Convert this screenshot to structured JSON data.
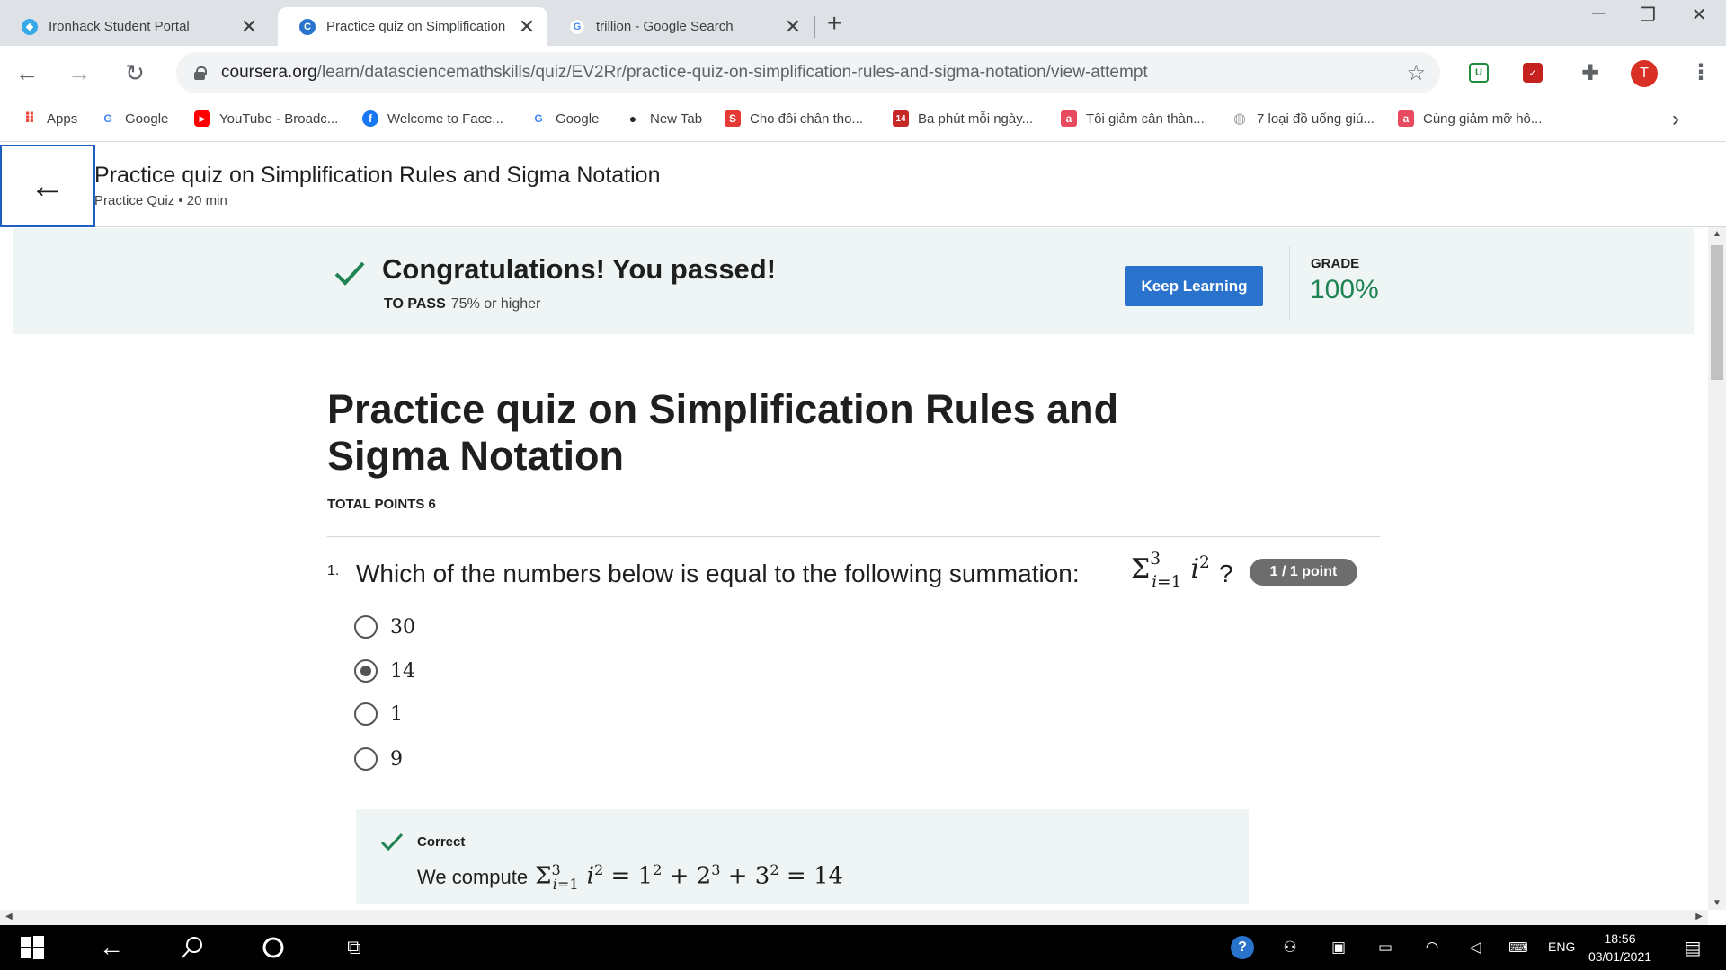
{
  "browser": {
    "tabs": [
      {
        "title": "Ironhack Student Portal",
        "active": false
      },
      {
        "title": "Practice quiz on Simplification",
        "active": true
      },
      {
        "title": "trillion - Google Search",
        "active": false
      }
    ],
    "new_tab_icon": "+",
    "url_host": "coursera.org",
    "url_path": "/learn/datasciencemathskills/quiz/EV2Rr/practice-quiz-on-simplification-rules-and-sigma-notation/view-attempt",
    "profile_initial": "T",
    "bookmarks": [
      {
        "label": "Apps",
        "icon": "apps-grid-icon"
      },
      {
        "label": "Google",
        "icon": "google-icon"
      },
      {
        "label": "YouTube - Broadc...",
        "icon": "youtube-icon"
      },
      {
        "label": "Welcome to Face...",
        "icon": "facebook-icon"
      },
      {
        "label": "Google",
        "icon": "google-icon"
      },
      {
        "label": "New Tab",
        "icon": "github-icon"
      },
      {
        "label": "Cho đôi chân tho...",
        "icon": "s-icon"
      },
      {
        "label": "Ba phút mỗi ngày...",
        "icon": "14-icon"
      },
      {
        "label": "Tôi giảm cân thàn...",
        "icon": "a-icon"
      },
      {
        "label": "7 loại đồ uống giú...",
        "icon": "globe-icon"
      },
      {
        "label": "Cùng giảm mỡ hô...",
        "icon": "a-icon"
      }
    ]
  },
  "header": {
    "title": "Practice quiz on Simplification Rules and Sigma Notation",
    "subtitle": "Practice Quiz • 20 min"
  },
  "result": {
    "message": "Congratulations! You passed!",
    "to_pass_label": "TO PASS",
    "to_pass_value": "75% or higher",
    "button_label": "Keep Learning",
    "grade_label": "GRADE",
    "grade_value": "100%"
  },
  "quiz": {
    "title": "Practice quiz on Simplification Rules and Sigma Notation",
    "total_points": "TOTAL POINTS 6",
    "question_number": "1.",
    "question_text": "Which of the numbers below is equal to the following summation:",
    "question_mark": "?",
    "points_badge": "1 / 1 point",
    "options": [
      {
        "label": "30",
        "selected": false
      },
      {
        "label": "14",
        "selected": true
      },
      {
        "label": "1",
        "selected": false
      },
      {
        "label": "9",
        "selected": false
      }
    ],
    "feedback": {
      "status": "Correct",
      "text": "We compute"
    }
  },
  "taskbar": {
    "language": "ENG",
    "time": "18:56",
    "date": "03/01/2021"
  },
  "colors": {
    "accent_blue": "#2a73cc",
    "success_green": "#1f8354",
    "banner_bg": "#eff5f4",
    "badge_gray": "#6d6d6d"
  }
}
